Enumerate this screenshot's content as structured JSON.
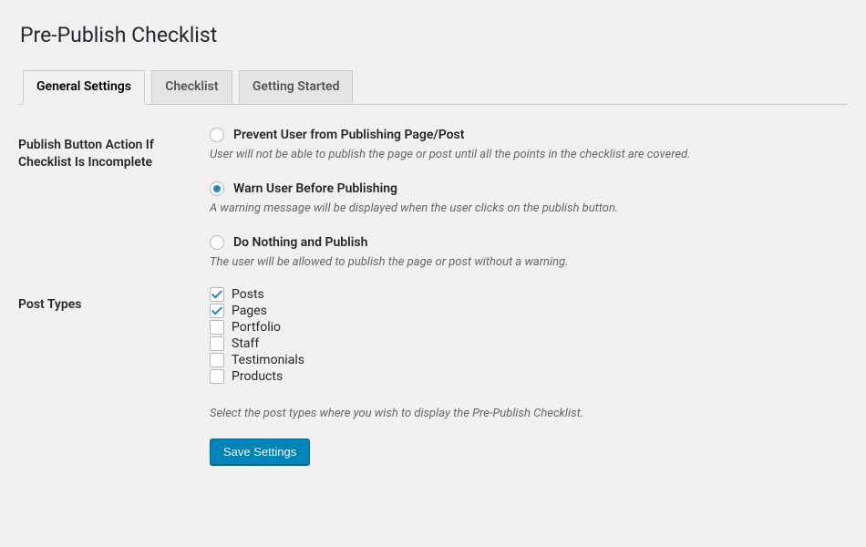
{
  "page": {
    "title": "Pre-Publish Checklist"
  },
  "tabs": [
    {
      "label": "General Settings",
      "active": true
    },
    {
      "label": "Checklist",
      "active": false
    },
    {
      "label": "Getting Started",
      "active": false
    }
  ],
  "settings": {
    "publish_action": {
      "heading": "Publish Button Action If Checklist Is Incomplete",
      "options": [
        {
          "label": "Prevent User from Publishing Page/Post",
          "description": "User will not be able to publish the page or post until all the points in the checklist are covered.",
          "checked": false
        },
        {
          "label": "Warn User Before Publishing",
          "description": "A warning message will be displayed when the user clicks on the publish button.",
          "checked": true
        },
        {
          "label": "Do Nothing and Publish",
          "description": "The user will be allowed to publish the page or post without a warning.",
          "checked": false
        }
      ]
    },
    "post_types": {
      "heading": "Post Types",
      "items": [
        {
          "label": "Posts",
          "checked": true
        },
        {
          "label": "Pages",
          "checked": true
        },
        {
          "label": "Portfolio",
          "checked": false
        },
        {
          "label": "Staff",
          "checked": false
        },
        {
          "label": "Testimonials",
          "checked": false
        },
        {
          "label": "Products",
          "checked": false
        }
      ],
      "description": "Select the post types where you wish to display the Pre-Publish Checklist."
    }
  },
  "buttons": {
    "save": "Save Settings"
  }
}
